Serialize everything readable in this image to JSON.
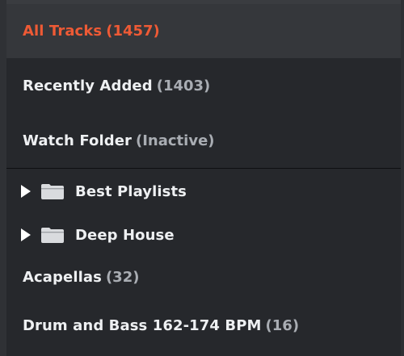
{
  "library": {
    "all_tracks": {
      "label": "All Tracks",
      "count": "(1457)"
    },
    "recently_added": {
      "label": "Recently Added",
      "count": "(1403)"
    },
    "watch_folder": {
      "label": "Watch Folder",
      "status": "(Inactive)"
    }
  },
  "playlists": [
    {
      "type": "folder",
      "label": "Best Playlists",
      "icon": "folder-icon",
      "expand_icon": "expand-triangle-icon"
    },
    {
      "type": "folder",
      "label": "Deep House",
      "icon": "folder-icon",
      "expand_icon": "expand-triangle-icon"
    },
    {
      "type": "playlist",
      "label": "Acapellas",
      "count": "(32)"
    },
    {
      "type": "playlist",
      "label": "Drum and Bass 162-174 BPM",
      "count": "(16)"
    }
  ],
  "colors": {
    "background": "#26282c",
    "selected_row": "#35373b",
    "accent": "#ee5a35",
    "text": "#eef0f2",
    "count_text": "#a9adb3",
    "divider": "#0e0f11"
  }
}
